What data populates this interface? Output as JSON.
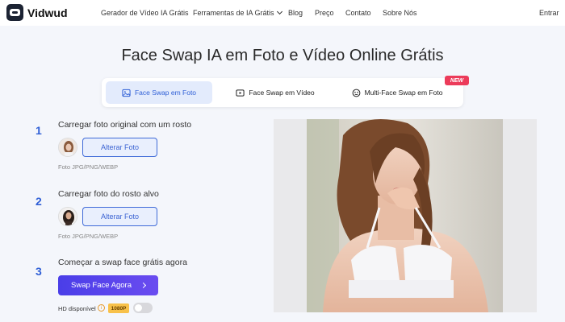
{
  "brand": {
    "name": "Vidwud"
  },
  "nav": {
    "items": [
      "Gerador de Vídeo IA Grátis",
      "Ferramentas de IA Grátis",
      "Blog",
      "Preço",
      "Contato",
      "Sobre Nós"
    ],
    "login": "Entrar"
  },
  "page": {
    "title": "Face Swap IA em Foto e Vídeo Online Grátis"
  },
  "tabs": [
    {
      "label": "Face Swap em Foto",
      "icon": "image-icon",
      "active": true
    },
    {
      "label": "Face Swap em Vídeo",
      "icon": "video-icon",
      "active": false
    },
    {
      "label": "Multi-Face Swap em Foto",
      "icon": "multi-face-icon",
      "active": false,
      "badge": "NEW"
    }
  ],
  "steps": [
    {
      "number": "1",
      "title": "Carregar foto original com um rosto",
      "button": "Alterar Foto",
      "formats": "Foto JPG/PNG/WEBP"
    },
    {
      "number": "2",
      "title": "Carregar foto do rosto alvo",
      "button": "Alterar Foto",
      "formats": "Foto JPG/PNG/WEBP"
    },
    {
      "number": "3",
      "title": "Começar a swap face grátis agora",
      "button": "Swap Face Agora"
    }
  ],
  "hd": {
    "label": "HD disponível",
    "badge": "1080P",
    "enabled": false
  },
  "colors": {
    "accent": "#2f5fd6",
    "primary_button": "#4a3ee8",
    "new_badge": "#ec3b5a",
    "hd_badge": "#f8c14a"
  }
}
